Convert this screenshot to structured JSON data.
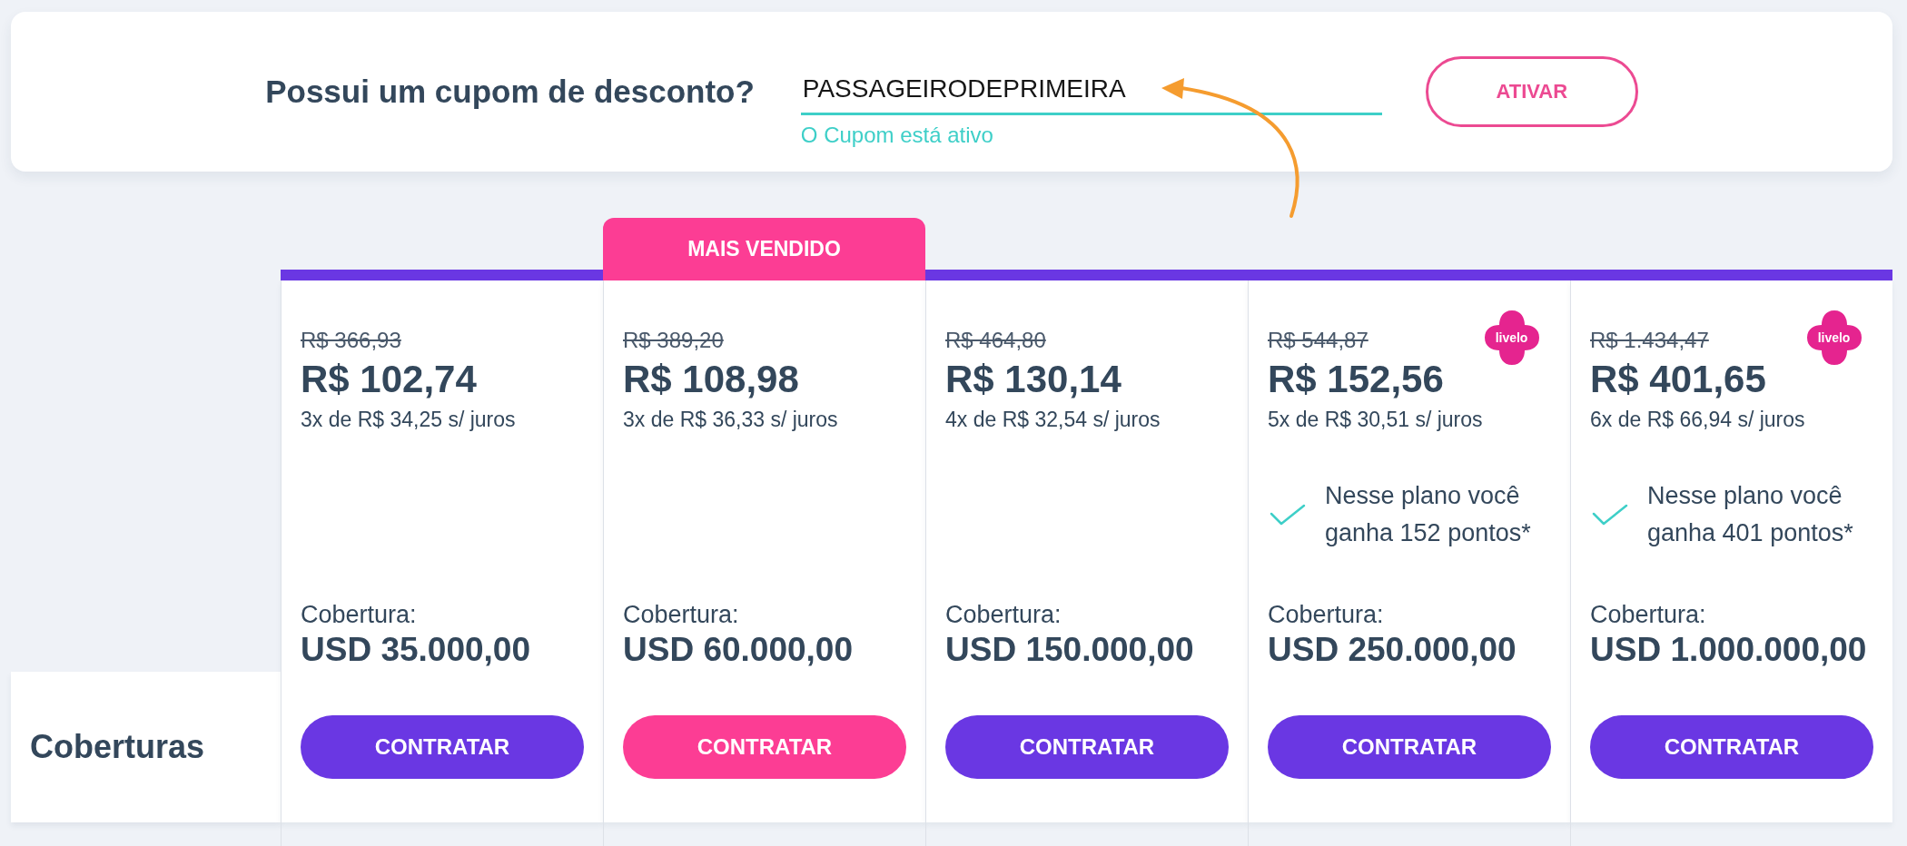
{
  "coupon": {
    "question": "Possui um cupom de desconto?",
    "code": "PASSAGEIRODEPRIMEIRA",
    "status": "O Cupom está ativo",
    "active": true,
    "button": "ATIVAR"
  },
  "annotations": [
    {
      "kind": "arrow"
    }
  ],
  "row_label": "Coberturas",
  "plans": [
    {
      "old_price": "R$ 366,93",
      "price": "R$ 102,74",
      "installments": "3x de R$ 34,25 s/ juros",
      "coverage_label": "Cobertura:",
      "coverage": "USD 35.000,00",
      "button": "CONTRATAR",
      "featured": false
    },
    {
      "badge": "MAIS VENDIDO",
      "old_price": "R$ 389,20",
      "price": "R$ 108,98",
      "installments": "3x de R$ 36,33 s/ juros",
      "coverage_label": "Cobertura:",
      "coverage": "USD 60.000,00",
      "button": "CONTRATAR",
      "featured": true
    },
    {
      "old_price": "R$ 464,80",
      "price": "R$ 130,14",
      "installments": "4x de R$ 32,54 s/ juros",
      "coverage_label": "Cobertura:",
      "coverage": "USD 150.000,00",
      "button": "CONTRATAR",
      "featured": false
    },
    {
      "old_price": "R$ 544,87",
      "price": "R$ 152,56",
      "logo": "livelo",
      "installments": "5x de R$ 30,51 s/ juros",
      "points": "Nesse plano você ganha 152 pontos*",
      "coverage_label": "Cobertura:",
      "coverage": "USD 250.000,00",
      "button": "CONTRATAR",
      "featured": false
    },
    {
      "old_price": "R$ 1.434,47",
      "price": "R$ 401,65",
      "logo": "livelo",
      "installments": "6x de R$ 66,94 s/ juros",
      "points": "Nesse plano você ganha 401 pontos*",
      "coverage_label": "Cobertura:",
      "coverage": "USD 1.000.000,00",
      "button": "CONTRATAR",
      "featured": false
    }
  ]
}
